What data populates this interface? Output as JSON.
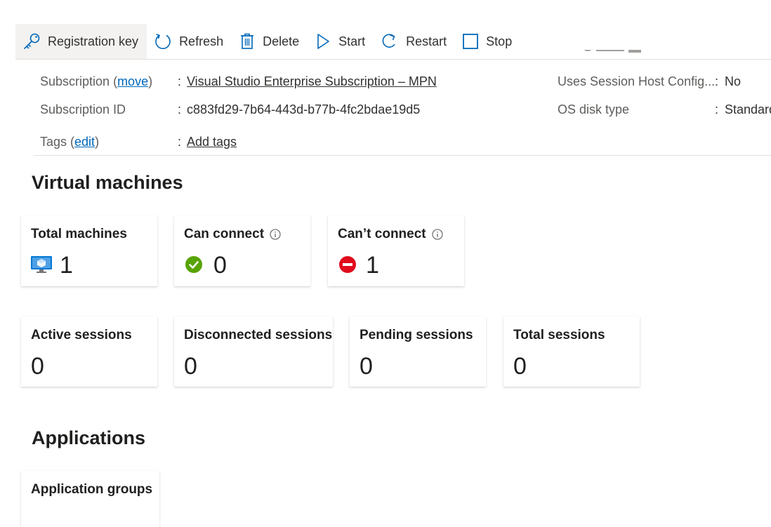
{
  "toolbar": {
    "registration_key": "Registration key",
    "refresh": "Refresh",
    "delete": "Delete",
    "start": "Start",
    "restart": "Restart",
    "stop": "Stop"
  },
  "essentials": {
    "subscription_label": "Subscription",
    "subscription_move": "move",
    "subscription_value": "Visual Studio Enterprise Subscription – MPN",
    "subscription_id_label": "Subscription ID",
    "subscription_id_value": "c883fd29-7b64-443d-b77b-4fc2bdae19d5",
    "tags_label": "Tags",
    "tags_edit": "edit",
    "tags_value": "Add tags",
    "session_host_config_label": "Uses Session Host Config...",
    "session_host_config_value": "No",
    "os_disk_type_label": "OS disk type",
    "os_disk_type_value": "Standard"
  },
  "virtual_machines": {
    "heading": "Virtual machines",
    "total_machines": {
      "title": "Total machines",
      "value": "1"
    },
    "can_connect": {
      "title": "Can connect",
      "value": "0"
    },
    "cant_connect": {
      "title": "Can’t connect",
      "value": "1"
    }
  },
  "sessions": {
    "active": {
      "title": "Active sessions",
      "value": "0"
    },
    "disconnected": {
      "title": "Disconnected sessions",
      "value": "0"
    },
    "pending": {
      "title": "Pending sessions",
      "value": "0"
    },
    "total": {
      "title": "Total sessions",
      "value": "0"
    }
  },
  "applications": {
    "heading": "Applications",
    "application_groups": {
      "title": "Application groups"
    }
  },
  "colors": {
    "accent": "#0067b8",
    "success": "#57a300",
    "error": "#e00b1c",
    "vm_blue": "#0078d4"
  }
}
